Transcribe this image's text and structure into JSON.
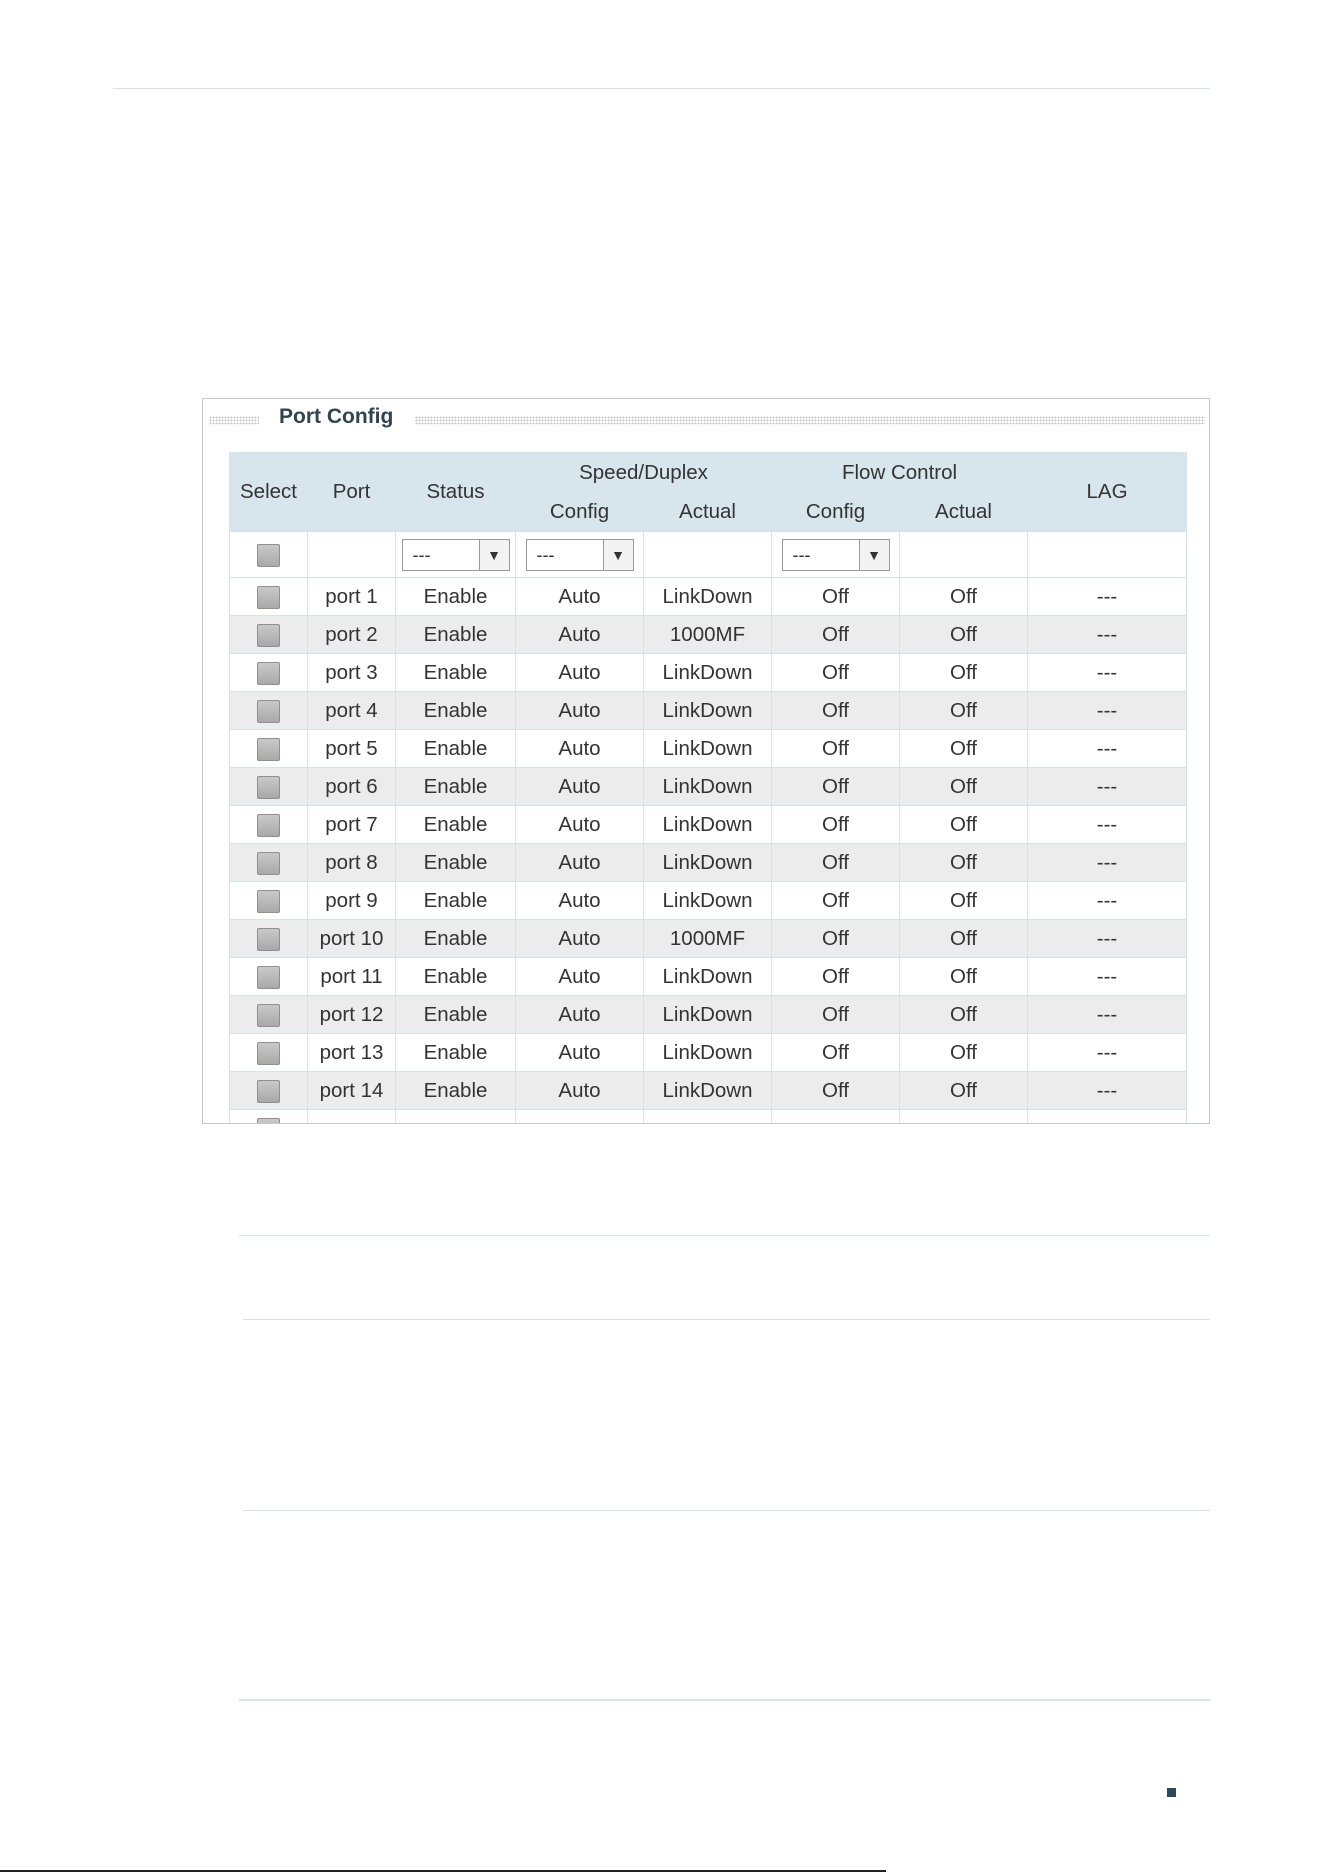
{
  "panel": {
    "title": "Port Config",
    "headers": {
      "select": "Select",
      "port": "Port",
      "status": "Status",
      "speed_duplex": "Speed/Duplex",
      "flow_control": "Flow Control",
      "lag": "LAG",
      "config": "Config",
      "actual": "Actual"
    },
    "filter": {
      "status_value": "---",
      "speed_config_value": "---",
      "flow_config_value": "---"
    },
    "rows": [
      {
        "port": "port 1",
        "status": "Enable",
        "speed_config": "Auto",
        "speed_actual": "LinkDown",
        "flow_config": "Off",
        "flow_actual": "Off",
        "lag": "---"
      },
      {
        "port": "port 2",
        "status": "Enable",
        "speed_config": "Auto",
        "speed_actual": "1000MF",
        "flow_config": "Off",
        "flow_actual": "Off",
        "lag": "---"
      },
      {
        "port": "port 3",
        "status": "Enable",
        "speed_config": "Auto",
        "speed_actual": "LinkDown",
        "flow_config": "Off",
        "flow_actual": "Off",
        "lag": "---"
      },
      {
        "port": "port 4",
        "status": "Enable",
        "speed_config": "Auto",
        "speed_actual": "LinkDown",
        "flow_config": "Off",
        "flow_actual": "Off",
        "lag": "---"
      },
      {
        "port": "port 5",
        "status": "Enable",
        "speed_config": "Auto",
        "speed_actual": "LinkDown",
        "flow_config": "Off",
        "flow_actual": "Off",
        "lag": "---"
      },
      {
        "port": "port 6",
        "status": "Enable",
        "speed_config": "Auto",
        "speed_actual": "LinkDown",
        "flow_config": "Off",
        "flow_actual": "Off",
        "lag": "---"
      },
      {
        "port": "port 7",
        "status": "Enable",
        "speed_config": "Auto",
        "speed_actual": "LinkDown",
        "flow_config": "Off",
        "flow_actual": "Off",
        "lag": "---"
      },
      {
        "port": "port 8",
        "status": "Enable",
        "speed_config": "Auto",
        "speed_actual": "LinkDown",
        "flow_config": "Off",
        "flow_actual": "Off",
        "lag": "---"
      },
      {
        "port": "port 9",
        "status": "Enable",
        "speed_config": "Auto",
        "speed_actual": "LinkDown",
        "flow_config": "Off",
        "flow_actual": "Off",
        "lag": "---"
      },
      {
        "port": "port 10",
        "status": "Enable",
        "speed_config": "Auto",
        "speed_actual": "1000MF",
        "flow_config": "Off",
        "flow_actual": "Off",
        "lag": "---"
      },
      {
        "port": "port 11",
        "status": "Enable",
        "speed_config": "Auto",
        "speed_actual": "LinkDown",
        "flow_config": "Off",
        "flow_actual": "Off",
        "lag": "---"
      },
      {
        "port": "port 12",
        "status": "Enable",
        "speed_config": "Auto",
        "speed_actual": "LinkDown",
        "flow_config": "Off",
        "flow_actual": "Off",
        "lag": "---"
      },
      {
        "port": "port 13",
        "status": "Enable",
        "speed_config": "Auto",
        "speed_actual": "LinkDown",
        "flow_config": "Off",
        "flow_actual": "Off",
        "lag": "---"
      },
      {
        "port": "port 14",
        "status": "Enable",
        "speed_config": "Auto",
        "speed_actual": "LinkDown",
        "flow_config": "Off",
        "flow_actual": "Off",
        "lag": "---"
      }
    ]
  }
}
